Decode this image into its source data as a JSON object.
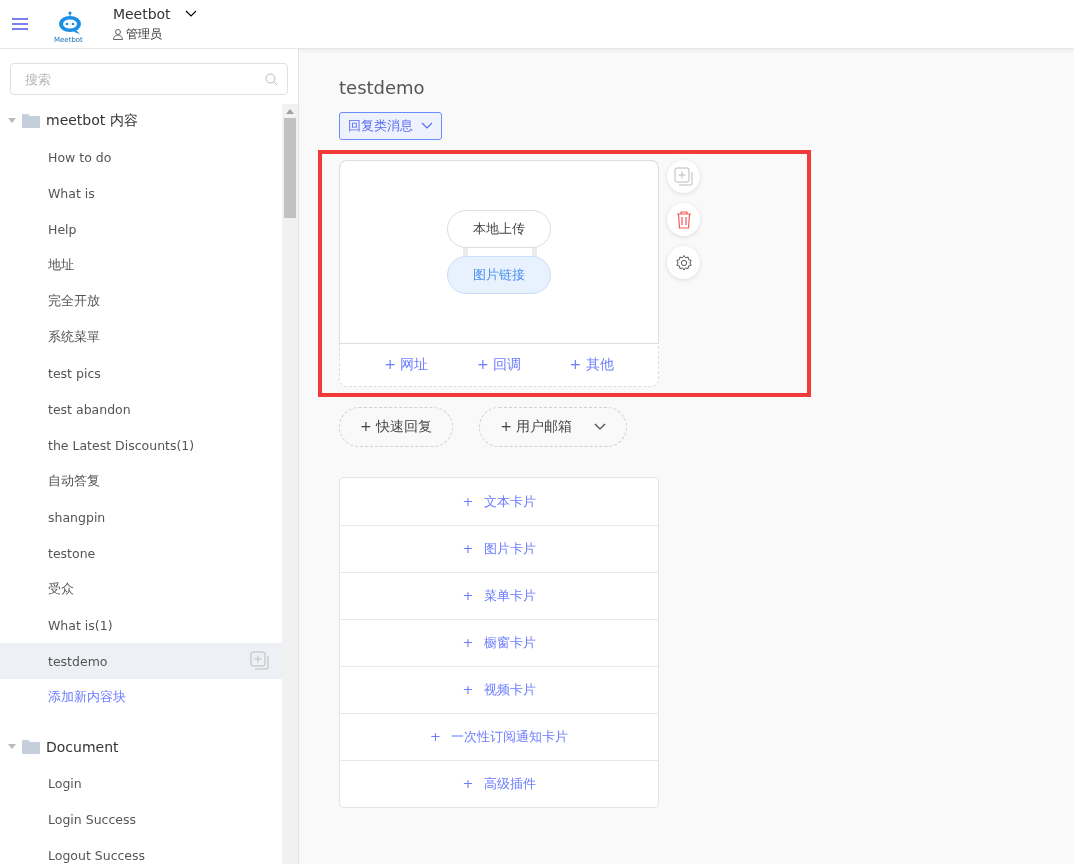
{
  "header": {
    "app_name": "Meetbot",
    "logo_text": "Meetbot",
    "role": "管理员"
  },
  "sidebar": {
    "search": {
      "placeholder": "搜索"
    },
    "groups": [
      {
        "label": "meetbot 内容",
        "expanded": true,
        "items": [
          {
            "label": "How to do",
            "selected": false
          },
          {
            "label": "What is",
            "selected": false
          },
          {
            "label": "Help",
            "selected": false
          },
          {
            "label": "地址",
            "selected": false
          },
          {
            "label": "完全开放",
            "selected": false
          },
          {
            "label": "系统菜單",
            "selected": false
          },
          {
            "label": "test pics",
            "selected": false
          },
          {
            "label": "test abandon",
            "selected": false
          },
          {
            "label": "the Latest Discounts(1)",
            "selected": false
          },
          {
            "label": "自动答复",
            "selected": false
          },
          {
            "label": "shangpin",
            "selected": false
          },
          {
            "label": "testone",
            "selected": false
          },
          {
            "label": "受众",
            "selected": false
          },
          {
            "label": "What is(1)",
            "selected": false
          },
          {
            "label": "testdemo",
            "selected": true
          }
        ],
        "add_link": "添加新内容块"
      },
      {
        "label": "Document",
        "expanded": true,
        "items": [
          {
            "label": "Login",
            "selected": false
          },
          {
            "label": "Login Success",
            "selected": false
          },
          {
            "label": "Logout Success",
            "selected": false
          }
        ]
      }
    ]
  },
  "main": {
    "title": "testdemo",
    "type_dropdown": "回复类消息",
    "image_card": {
      "upload_button": "本地上传",
      "link_button": "图片链接",
      "actions": [
        "+ 网址",
        "+ 回调",
        "+ 其他"
      ]
    },
    "quick_buttons": [
      {
        "label": "+ 快速回复",
        "dropdown": false
      },
      {
        "label": "+ 用户邮箱",
        "dropdown": true
      }
    ],
    "add_cards": [
      "+ 文本卡片",
      "+ 图片卡片",
      "+ 菜单卡片",
      "+ 橱窗卡片",
      "+ 视频卡片",
      "+ 一次性订阅通知卡片",
      "+ 高级插件"
    ]
  }
}
